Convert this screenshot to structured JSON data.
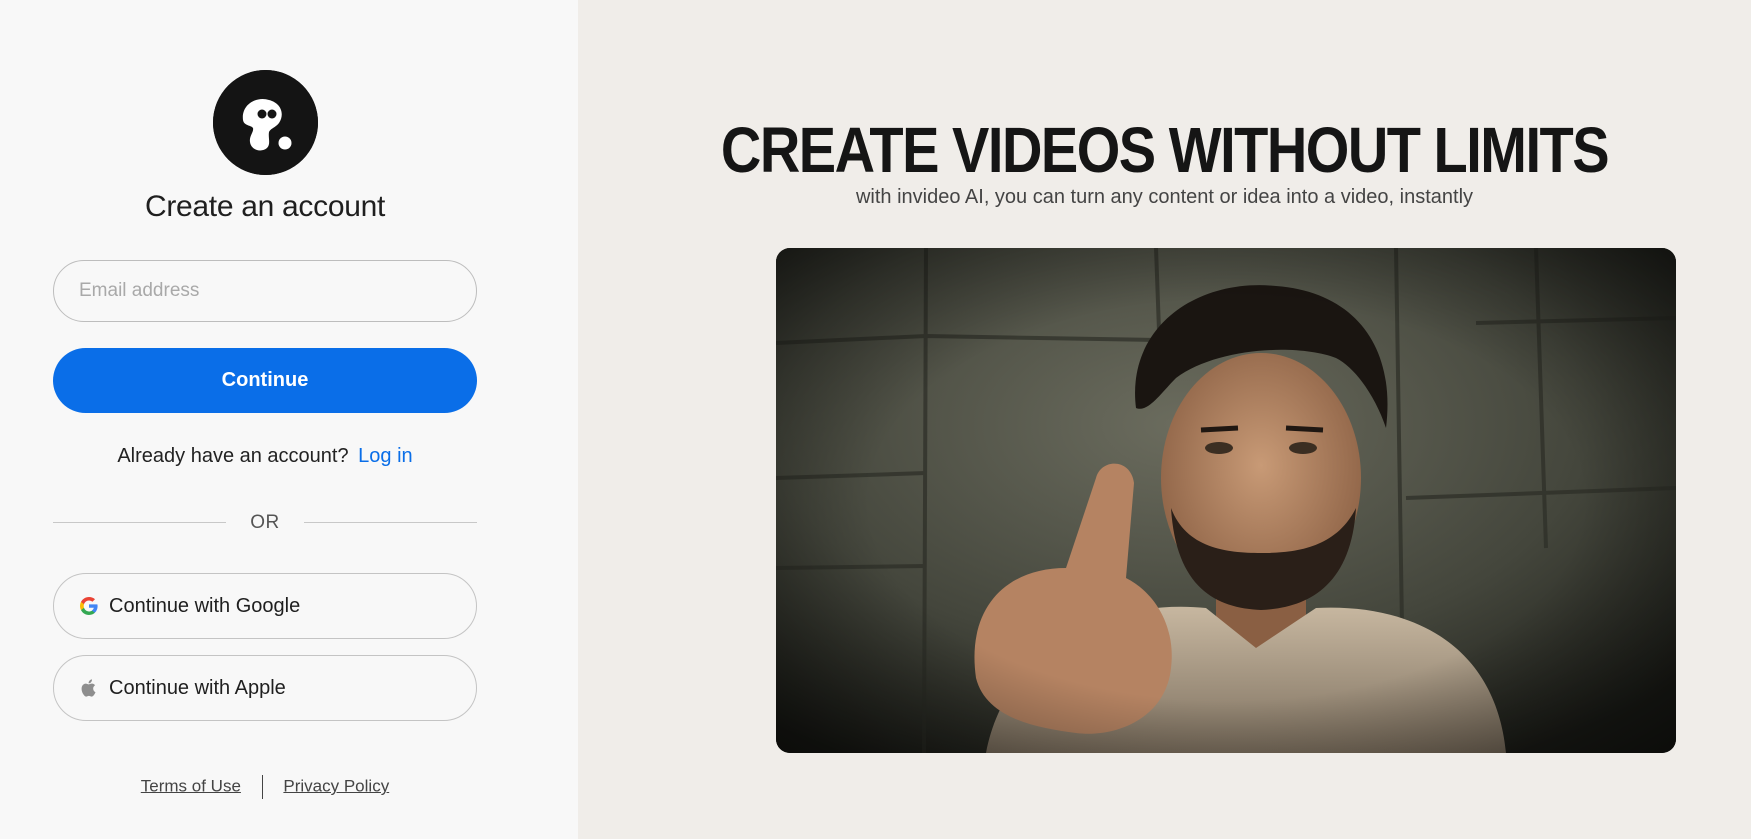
{
  "auth": {
    "title": "Create an account",
    "email_placeholder": "Email address",
    "continue_label": "Continue",
    "already_text": "Already have an account?",
    "login_label": "Log in",
    "or_text": "OR",
    "google_label": "Continue with Google",
    "apple_label": "Continue with Apple",
    "terms_label": "Terms of Use",
    "privacy_label": "Privacy Policy"
  },
  "promo": {
    "headline": "CREATE VIDEOS WITHOUT LIMITS",
    "subheadline": "with invideo AI, you can turn any content or idea into a video, instantly"
  },
  "colors": {
    "accent": "#0a6ee8",
    "left_bg": "#f8f8f8",
    "right_bg": "#f0ede9",
    "logo_bg": "#141414"
  },
  "icons": {
    "logo": "invideo-logo-icon",
    "google": "google-icon",
    "apple": "apple-icon"
  }
}
